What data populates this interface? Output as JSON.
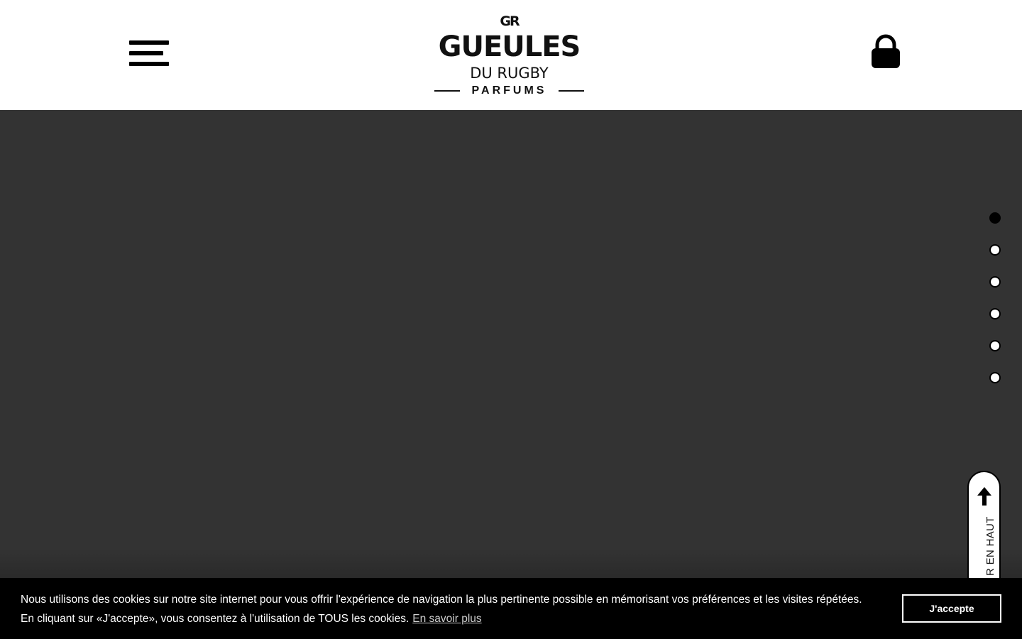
{
  "header": {
    "logo": {
      "monogram": "GR",
      "line1": "GUEULES",
      "line2": "DU RUGBY",
      "line3": "PARFUMS"
    },
    "menu_icon": "hamburger-menu-icon",
    "cart_icon": "shopping-bag-lock-icon"
  },
  "hero": {
    "background_color": "#333333",
    "slides_total": 6,
    "active_slide": 1
  },
  "back_to_top": {
    "label": "R EN HAUT",
    "icon": "arrow-up-icon"
  },
  "cookie_banner": {
    "line1": "Nous utilisons des cookies sur notre site internet pour vous offrir l'expérience de navigation la plus pertinente possible en mémorisant vos préférences et les visites répétées.",
    "line2": "En cliquant sur «J'accepte», vous consentez à l'utilisation de TOUS les cookies.",
    "learn_more": "En savoir plus",
    "accept_label": "J'accepte"
  },
  "colors": {
    "header_bg": "#ffffff",
    "hero_bg": "#333333",
    "banner_bg": "#000000",
    "accent": "#000000"
  }
}
